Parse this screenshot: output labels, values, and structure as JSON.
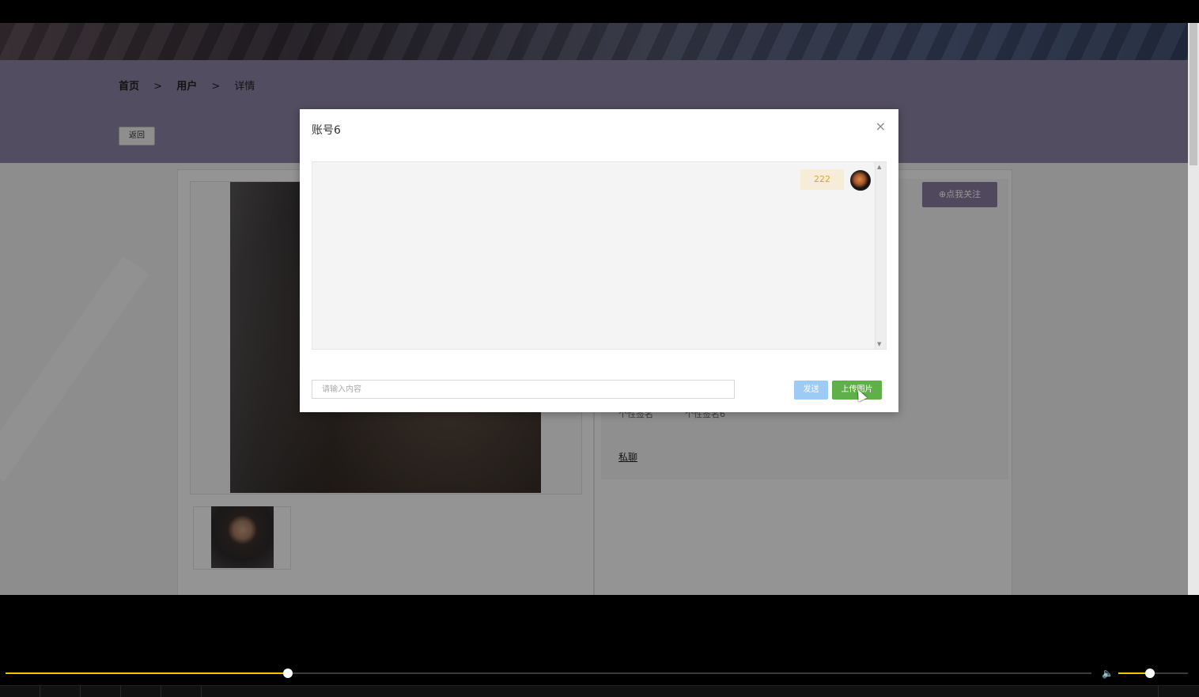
{
  "page": {
    "breadcrumb": {
      "home": "首页",
      "sep1": ">",
      "users": "用户",
      "sep2": ">",
      "detail": "详情"
    },
    "back_label": "返回",
    "follow_label": "⊕点我关注",
    "signature_label": "个性签名",
    "signature_value": "个性签名6",
    "private_chat_label": "私聊"
  },
  "modal": {
    "title": "账号6",
    "close_glyph": "×",
    "messages": [
      {
        "text": "222",
        "sender": "self"
      }
    ],
    "input_placeholder": "请输入内容",
    "send_label": "发送",
    "upload_label": "上传图片"
  },
  "player": {
    "progress": 0.26,
    "volume": 0.45
  },
  "colors": {
    "header_purple": "#8e85a6",
    "send_blue": "#9ecbf5",
    "upload_green": "#5fb04a",
    "bubble_bg": "#f6ecd7",
    "bubble_text": "#e3a23e",
    "progress_yellow": "#f5c400"
  }
}
